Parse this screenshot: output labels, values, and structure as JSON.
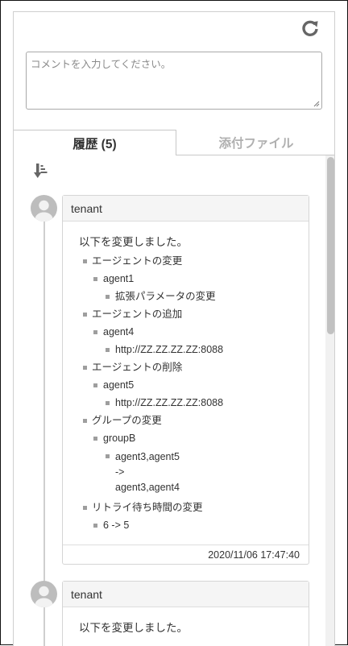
{
  "comment": {
    "placeholder": "コメントを入力してください。"
  },
  "tabs": {
    "history": "履歴 (5)",
    "attachments": "添付ファイル"
  },
  "icons": {
    "refresh": "refresh-icon",
    "sort": "sort-descending-icon",
    "avatar": "user-avatar-icon"
  },
  "entries": [
    {
      "user": "tenant",
      "title": "以下を変更しました。",
      "changes": [
        {
          "label": "エージェントの変更",
          "items": [
            {
              "label": "agent1",
              "details": [
                "拡張パラメータの変更"
              ]
            }
          ]
        },
        {
          "label": "エージェントの追加",
          "items": [
            {
              "label": "agent4",
              "details": [
                "http://ZZ.ZZ.ZZ.ZZ:8088"
              ]
            }
          ]
        },
        {
          "label": "エージェントの削除",
          "items": [
            {
              "label": "agent5",
              "details": [
                "http://ZZ.ZZ.ZZ.ZZ:8088"
              ]
            }
          ]
        },
        {
          "label": "グループの変更",
          "items": [
            {
              "label": "groupB",
              "details_multi": [
                "agent3,agent5",
                "->",
                "agent3,agent4"
              ]
            }
          ]
        },
        {
          "label": "リトライ待ち時間の変更",
          "items": [
            {
              "label": "6 -> 5"
            }
          ]
        }
      ],
      "timestamp": "2020/11/06 17:47:40"
    },
    {
      "user": "tenant",
      "title": "以下を変更しました。"
    }
  ],
  "colors": {
    "bullet": "#9e9e9e",
    "inactive_tab": "#b0b0b0",
    "card_header": "#f5f5f5",
    "avatar": "#bdbdbd"
  }
}
